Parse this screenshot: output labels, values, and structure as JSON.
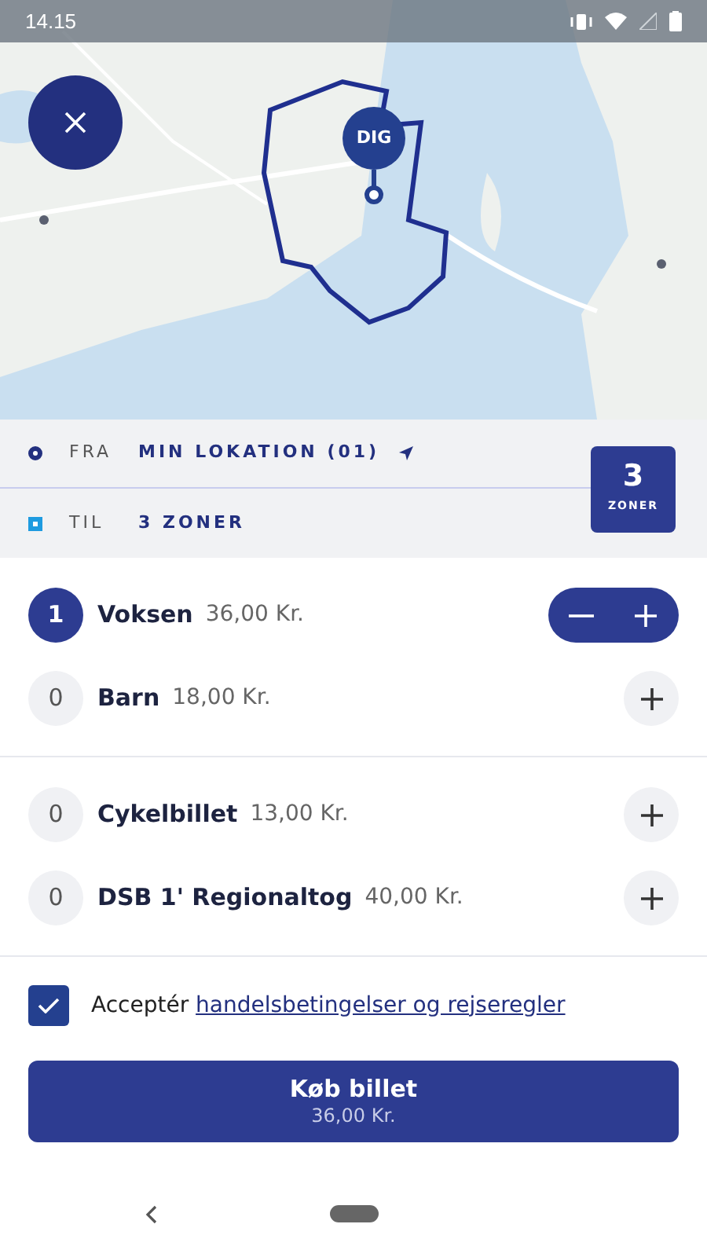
{
  "status_bar": {
    "time": "14.15"
  },
  "map": {
    "kind": "picture",
    "pin_label": "DIG"
  },
  "route": {
    "from_label": "FRA",
    "from_value": "MIN LOKATION (01)",
    "to_label": "TIL",
    "to_value": "3 ZONER",
    "zone_count": "3",
    "zone_unit": "ZONER"
  },
  "ticket_groups": [
    {
      "tickets": [
        {
          "count": "1",
          "name": "Voksen",
          "price": "36,00 Kr.",
          "active": true
        },
        {
          "count": "0",
          "name": "Barn",
          "price": "18,00 Kr.",
          "active": false
        }
      ]
    },
    {
      "tickets": [
        {
          "count": "0",
          "name": "Cykelbillet",
          "price": "13,00 Kr.",
          "active": false
        },
        {
          "count": "0",
          "name": "DSB 1' Regionaltog",
          "price": "40,00 Kr.",
          "active": false
        }
      ]
    }
  ],
  "terms": {
    "checked": true,
    "prefix": "Acceptér",
    "link": "handelsbetingelser og rejseregler"
  },
  "buy_button": {
    "label": "Køb billet",
    "price": "36,00 Kr."
  }
}
